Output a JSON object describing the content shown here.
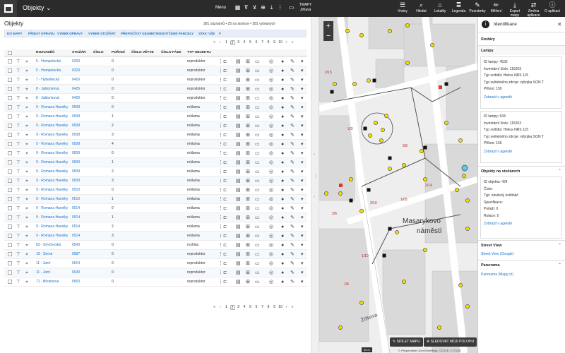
{
  "app": {
    "title": "Objekty",
    "menu_label": "Menu",
    "user_line1": "TMAPY",
    "user_line2": "Jihlava"
  },
  "map_toolbar": [
    "Vrstvy",
    "Hledat",
    "Lokality",
    "Legenda",
    "Poznámky",
    "Měření",
    "Export mapy",
    "Změna aplikace",
    "O aplikaci"
  ],
  "objects": {
    "title": "Objekty",
    "pager_info": "281 záznamů • 25 na stránce • 281 vybraných",
    "actions": [
      "DO MAPY",
      "PŘIDAT OPRAVU",
      "VYBER OPRAVY",
      "VYBER STOŽÁRY",
      "PŘEPOČÍTAT GEOMETRIE",
      "DOTČENÉ PARCELY",
      "STAV: VŠE"
    ],
    "pages": [
      "«",
      "‹",
      "1",
      "2",
      "3",
      "4",
      "5",
      "6",
      "7",
      "8",
      "9",
      "10",
      "›",
      "»"
    ],
    "active_page": "2",
    "columns": [
      "ROZVADĚČ",
      "STOŽÁR",
      "ČÍSLO",
      "POŘADÍ",
      "ČÍSLO VĚTVE",
      "ČÍSLO FÁZE",
      "TYP OBJEKTU"
    ],
    "rows": [
      [
        "5 - Humpolecká",
        "0293",
        "",
        "0",
        "",
        "",
        "reproduktor"
      ],
      [
        "5 - Humpolecká",
        "0320",
        "",
        "0",
        "",
        "",
        "reproduktor"
      ],
      [
        "7 - Hybešlecká",
        "0416",
        "",
        "0",
        "",
        "",
        "reproduktor"
      ],
      [
        "8 - Jablonková",
        "0425",
        "",
        "0",
        "",
        "",
        "reproduktor"
      ],
      [
        "8 - Jablonková",
        "0426",
        "",
        "0",
        "",
        "",
        "reproduktor"
      ],
      [
        "9 - Romana Havelky",
        "0508",
        "",
        "0",
        "",
        "",
        "reklama"
      ],
      [
        "9 - Romana Havelky",
        "0508",
        "",
        "1",
        "",
        "",
        "reklama"
      ],
      [
        "9 - Romana Havelky",
        "0508",
        "",
        "2",
        "",
        "",
        "reklama"
      ],
      [
        "9 - Romana Havelky",
        "0508",
        "",
        "3",
        "",
        "",
        "reklama"
      ],
      [
        "9 - Romana Havelky",
        "0508",
        "",
        "4",
        "",
        "",
        "reklama"
      ],
      [
        "9 - Romana Havelky",
        "0509",
        "",
        "0",
        "",
        "",
        "reklama"
      ],
      [
        "9 - Romana Havelky",
        "0509",
        "",
        "1",
        "",
        "",
        "reklama"
      ],
      [
        "9 - Romana Havelky",
        "0509",
        "",
        "2",
        "",
        "",
        "reklama"
      ],
      [
        "9 - Romana Havelky",
        "0509",
        "",
        "3",
        "",
        "",
        "reklama"
      ],
      [
        "9 - Romana Havelky",
        "0510",
        "",
        "0",
        "",
        "",
        "reklama"
      ],
      [
        "9 - Romana Havelky",
        "0510",
        "",
        "1",
        "",
        "",
        "reklama"
      ],
      [
        "9 - Romana Havelky",
        "0514",
        "",
        "0",
        "",
        "",
        "reklama"
      ],
      [
        "9 - Romana Havelky",
        "0514",
        "",
        "1",
        "",
        "",
        "reklama"
      ],
      [
        "9 - Romana Havelky",
        "0514",
        "",
        "2",
        "",
        "",
        "reklama"
      ],
      [
        "9 - Romana Havelky",
        "0514",
        "",
        "3",
        "",
        "",
        "reklama"
      ],
      [
        "83 - Smrčenská",
        "0543",
        "",
        "0",
        "",
        "",
        "rozhlas"
      ],
      [
        "10 - Strmá",
        "0587",
        "",
        "0",
        "",
        "",
        "reproduktor"
      ],
      [
        "11 - Jamí",
        "0614",
        "",
        "0",
        "",
        "",
        "reproduktor"
      ],
      [
        "11 - Jamí",
        "0630",
        "",
        "0",
        "",
        "",
        "reproduktor"
      ],
      [
        "71 - Březinova",
        "0653",
        "",
        "0",
        "",
        "",
        "reproduktor"
      ]
    ]
  },
  "map": {
    "zoom_in": "+",
    "zoom_out": "−",
    "labels": [
      "Masarykovo",
      "náměstí",
      "Žižkova"
    ],
    "btn_share": "SDÍLET MAPU",
    "btn_follow": "SLEDOVAT MOJI POLOHU",
    "scale": "50 m",
    "attribution": "© Přispěvatelé OpenStreetMap, ©ČÚZK, © ČÚZK"
  },
  "identify": {
    "title": "Identifikace",
    "section_stozary": "Stožáry",
    "section_lampy": "Lampy",
    "lamp1": [
      "ID lampy: 4532",
      "Inventární číslo: 115263",
      "Typ svítidla: Helius NRS 115",
      "Typ světelného zdroje: výbojka SON T",
      "Příkon: 150"
    ],
    "lamp2": [
      "ID lampy: 634",
      "Inventární číslo: 115263",
      "Typ svítidla: Helius NRS 115",
      "Typ světelného zdroje: výbojka SON T",
      "Příkon: 150"
    ],
    "show_in_agenda": "Zobrazit v agendě",
    "section_objekty": "Objekty na stožárech",
    "obj": [
      "ID objektu: 424",
      "Číslo:",
      "Typ: závěsný květináč",
      "Specifikace:",
      "Pořadí: 0",
      "Rotace: 0"
    ],
    "section_street": "Street View",
    "street_link": "Street View (Google)",
    "section_panorama": "Panorama",
    "panorama_link": "Panorama (Mapy.cz)",
    "accent": "#1a73c9"
  }
}
